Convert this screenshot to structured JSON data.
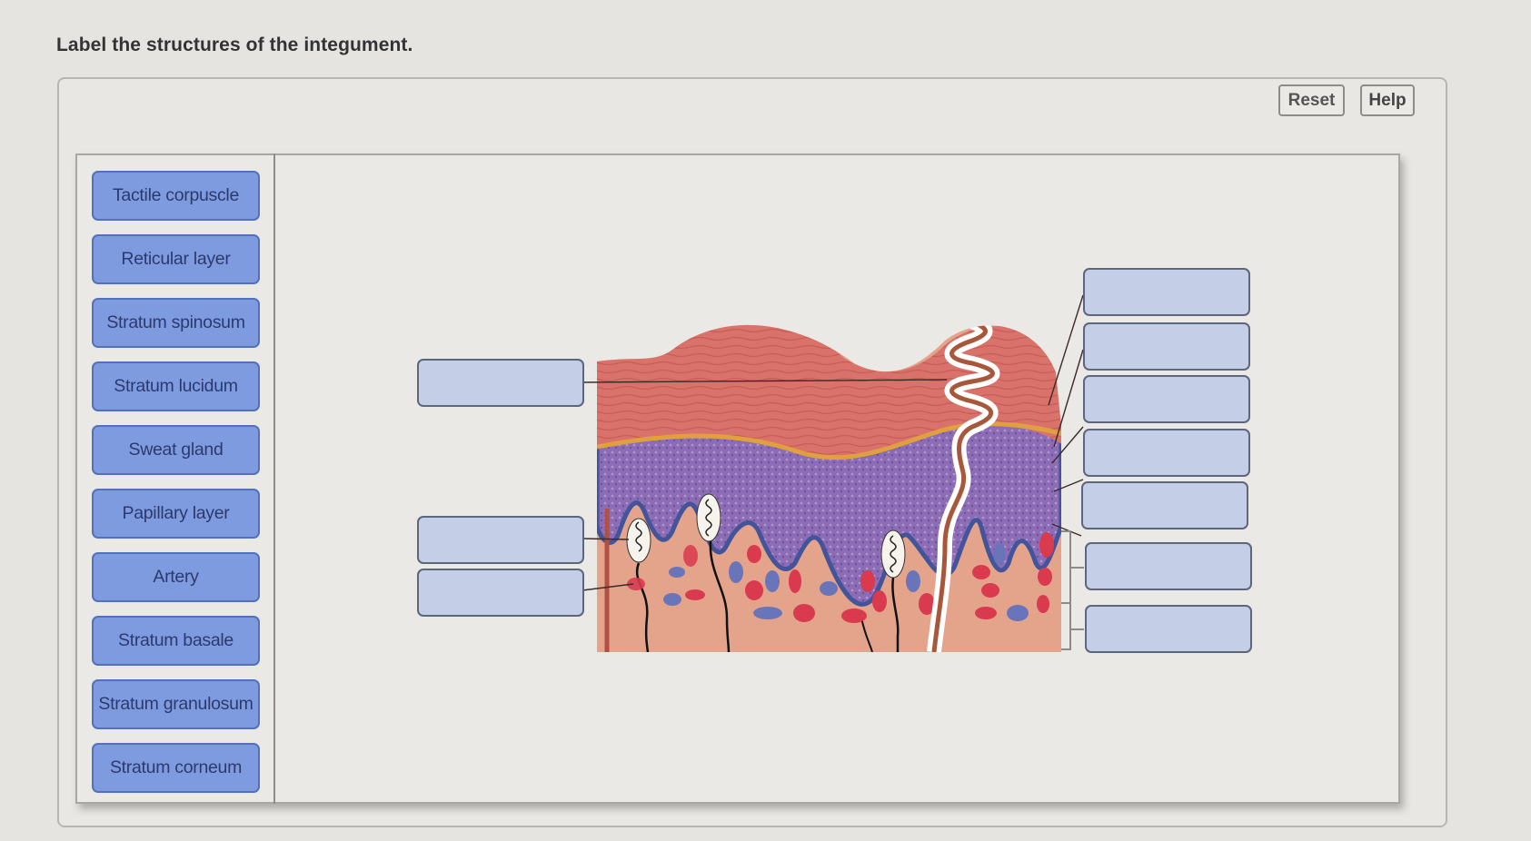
{
  "question": {
    "title": "Label the structures of the integument."
  },
  "toolbar": {
    "reset_label": "Reset",
    "help_label": "Help"
  },
  "labels": [
    {
      "text": "Tactile corpuscle"
    },
    {
      "text": "Reticular layer"
    },
    {
      "text": "Stratum spinosum"
    },
    {
      "text": "Stratum lucidum"
    },
    {
      "text": "Sweat gland"
    },
    {
      "text": "Papillary layer"
    },
    {
      "text": "Artery"
    },
    {
      "text": "Stratum basale"
    },
    {
      "text": "Stratum granulosum"
    },
    {
      "text": "Stratum corneum"
    }
  ],
  "drop_zones": {
    "left": [
      {
        "value": ""
      },
      {
        "value": ""
      },
      {
        "value": ""
      }
    ],
    "right": [
      {
        "value": ""
      },
      {
        "value": ""
      },
      {
        "value": ""
      },
      {
        "value": ""
      },
      {
        "value": ""
      },
      {
        "value": ""
      },
      {
        "value": ""
      }
    ]
  },
  "diagram": {
    "subject": "skin cross-section (integument)",
    "colors": {
      "stratum_corneum": "#d9726a",
      "stratum_lucidum": "#e0a040",
      "epidermis_deep": "#8e6bb3",
      "basal_edge": "#4c5fa0",
      "dermis": "#e3a48b",
      "vessel_red": "#d93a4e",
      "vessel_blue": "#6a74b8"
    }
  },
  "colors": {
    "label_fill": "#7f9be0",
    "label_border": "#5170bd",
    "label_text": "#2b3a6e",
    "drop_fill": "#c4cee7",
    "drop_border": "#5d667d",
    "background": "#e6e4e0"
  }
}
